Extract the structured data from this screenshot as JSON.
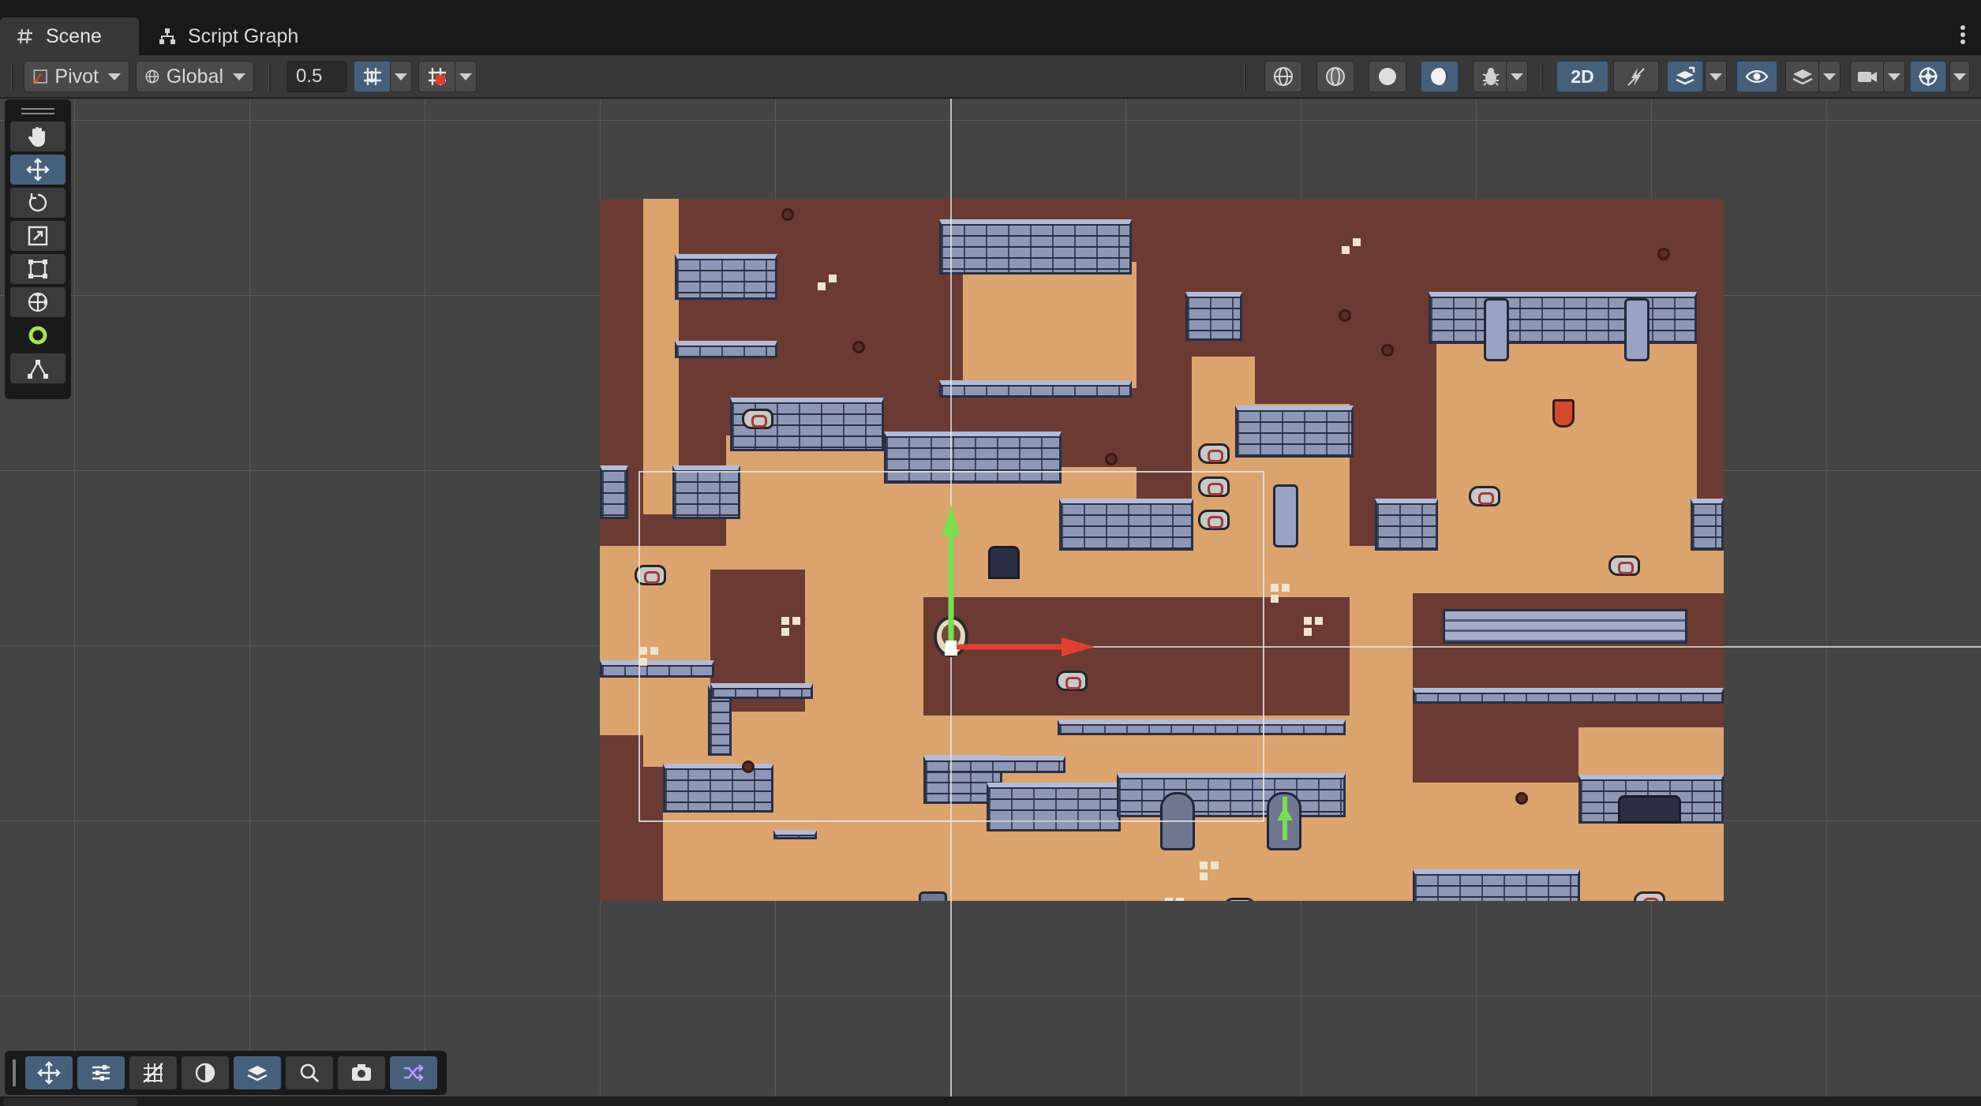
{
  "tabs": {
    "scene_label": "Scene",
    "script_graph_label": "Script Graph"
  },
  "toolbar": {
    "pivot_label": "Pivot",
    "global_label": "Global",
    "snap_value": "0.5",
    "mode_2d_label": "2D"
  },
  "icons": {
    "scene_tab": "hash-icon",
    "script_graph_tab": "hierarchy-icon",
    "tools": [
      "hand-icon",
      "move-icon",
      "rotate-icon",
      "scale-icon",
      "rect-tool-icon",
      "transform-icon",
      "custom-tool-circle-icon",
      "spline-tool-icon"
    ],
    "overlays": [
      "move-icon",
      "sliders-icon",
      "grid-icon",
      "shading-icon",
      "layers-icon",
      "search-icon",
      "camera-icon",
      "shuffle-icon"
    ]
  },
  "colors": {
    "accent_active": "#46607c",
    "dirt": "#6b3a33",
    "sand": "#dba36e",
    "stone": "#8e97b6",
    "x_axis": "#e0412f",
    "y_axis": "#7ddc4f",
    "custom_tool": "#a5e34d"
  }
}
